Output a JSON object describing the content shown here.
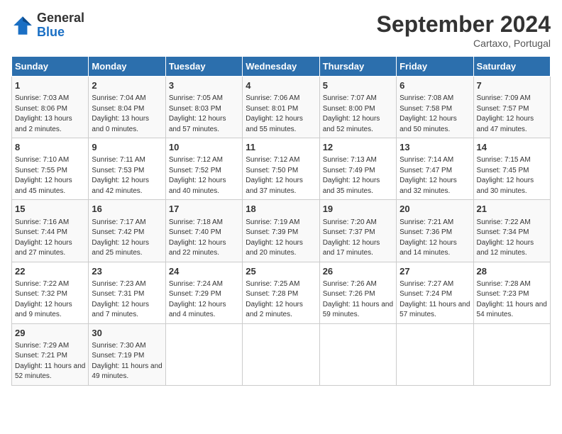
{
  "header": {
    "logo_general": "General",
    "logo_blue": "Blue",
    "month_title": "September 2024",
    "location": "Cartaxo, Portugal"
  },
  "days_of_week": [
    "Sunday",
    "Monday",
    "Tuesday",
    "Wednesday",
    "Thursday",
    "Friday",
    "Saturday"
  ],
  "weeks": [
    [
      {
        "day": "1",
        "sunrise": "Sunrise: 7:03 AM",
        "sunset": "Sunset: 8:06 PM",
        "daylight": "Daylight: 13 hours and 2 minutes."
      },
      {
        "day": "2",
        "sunrise": "Sunrise: 7:04 AM",
        "sunset": "Sunset: 8:04 PM",
        "daylight": "Daylight: 13 hours and 0 minutes."
      },
      {
        "day": "3",
        "sunrise": "Sunrise: 7:05 AM",
        "sunset": "Sunset: 8:03 PM",
        "daylight": "Daylight: 12 hours and 57 minutes."
      },
      {
        "day": "4",
        "sunrise": "Sunrise: 7:06 AM",
        "sunset": "Sunset: 8:01 PM",
        "daylight": "Daylight: 12 hours and 55 minutes."
      },
      {
        "day": "5",
        "sunrise": "Sunrise: 7:07 AM",
        "sunset": "Sunset: 8:00 PM",
        "daylight": "Daylight: 12 hours and 52 minutes."
      },
      {
        "day": "6",
        "sunrise": "Sunrise: 7:08 AM",
        "sunset": "Sunset: 7:58 PM",
        "daylight": "Daylight: 12 hours and 50 minutes."
      },
      {
        "day": "7",
        "sunrise": "Sunrise: 7:09 AM",
        "sunset": "Sunset: 7:57 PM",
        "daylight": "Daylight: 12 hours and 47 minutes."
      }
    ],
    [
      {
        "day": "8",
        "sunrise": "Sunrise: 7:10 AM",
        "sunset": "Sunset: 7:55 PM",
        "daylight": "Daylight: 12 hours and 45 minutes."
      },
      {
        "day": "9",
        "sunrise": "Sunrise: 7:11 AM",
        "sunset": "Sunset: 7:53 PM",
        "daylight": "Daylight: 12 hours and 42 minutes."
      },
      {
        "day": "10",
        "sunrise": "Sunrise: 7:12 AM",
        "sunset": "Sunset: 7:52 PM",
        "daylight": "Daylight: 12 hours and 40 minutes."
      },
      {
        "day": "11",
        "sunrise": "Sunrise: 7:12 AM",
        "sunset": "Sunset: 7:50 PM",
        "daylight": "Daylight: 12 hours and 37 minutes."
      },
      {
        "day": "12",
        "sunrise": "Sunrise: 7:13 AM",
        "sunset": "Sunset: 7:49 PM",
        "daylight": "Daylight: 12 hours and 35 minutes."
      },
      {
        "day": "13",
        "sunrise": "Sunrise: 7:14 AM",
        "sunset": "Sunset: 7:47 PM",
        "daylight": "Daylight: 12 hours and 32 minutes."
      },
      {
        "day": "14",
        "sunrise": "Sunrise: 7:15 AM",
        "sunset": "Sunset: 7:45 PM",
        "daylight": "Daylight: 12 hours and 30 minutes."
      }
    ],
    [
      {
        "day": "15",
        "sunrise": "Sunrise: 7:16 AM",
        "sunset": "Sunset: 7:44 PM",
        "daylight": "Daylight: 12 hours and 27 minutes."
      },
      {
        "day": "16",
        "sunrise": "Sunrise: 7:17 AM",
        "sunset": "Sunset: 7:42 PM",
        "daylight": "Daylight: 12 hours and 25 minutes."
      },
      {
        "day": "17",
        "sunrise": "Sunrise: 7:18 AM",
        "sunset": "Sunset: 7:40 PM",
        "daylight": "Daylight: 12 hours and 22 minutes."
      },
      {
        "day": "18",
        "sunrise": "Sunrise: 7:19 AM",
        "sunset": "Sunset: 7:39 PM",
        "daylight": "Daylight: 12 hours and 20 minutes."
      },
      {
        "day": "19",
        "sunrise": "Sunrise: 7:20 AM",
        "sunset": "Sunset: 7:37 PM",
        "daylight": "Daylight: 12 hours and 17 minutes."
      },
      {
        "day": "20",
        "sunrise": "Sunrise: 7:21 AM",
        "sunset": "Sunset: 7:36 PM",
        "daylight": "Daylight: 12 hours and 14 minutes."
      },
      {
        "day": "21",
        "sunrise": "Sunrise: 7:22 AM",
        "sunset": "Sunset: 7:34 PM",
        "daylight": "Daylight: 12 hours and 12 minutes."
      }
    ],
    [
      {
        "day": "22",
        "sunrise": "Sunrise: 7:22 AM",
        "sunset": "Sunset: 7:32 PM",
        "daylight": "Daylight: 12 hours and 9 minutes."
      },
      {
        "day": "23",
        "sunrise": "Sunrise: 7:23 AM",
        "sunset": "Sunset: 7:31 PM",
        "daylight": "Daylight: 12 hours and 7 minutes."
      },
      {
        "day": "24",
        "sunrise": "Sunrise: 7:24 AM",
        "sunset": "Sunset: 7:29 PM",
        "daylight": "Daylight: 12 hours and 4 minutes."
      },
      {
        "day": "25",
        "sunrise": "Sunrise: 7:25 AM",
        "sunset": "Sunset: 7:28 PM",
        "daylight": "Daylight: 12 hours and 2 minutes."
      },
      {
        "day": "26",
        "sunrise": "Sunrise: 7:26 AM",
        "sunset": "Sunset: 7:26 PM",
        "daylight": "Daylight: 11 hours and 59 minutes."
      },
      {
        "day": "27",
        "sunrise": "Sunrise: 7:27 AM",
        "sunset": "Sunset: 7:24 PM",
        "daylight": "Daylight: 11 hours and 57 minutes."
      },
      {
        "day": "28",
        "sunrise": "Sunrise: 7:28 AM",
        "sunset": "Sunset: 7:23 PM",
        "daylight": "Daylight: 11 hours and 54 minutes."
      }
    ],
    [
      {
        "day": "29",
        "sunrise": "Sunrise: 7:29 AM",
        "sunset": "Sunset: 7:21 PM",
        "daylight": "Daylight: 11 hours and 52 minutes."
      },
      {
        "day": "30",
        "sunrise": "Sunrise: 7:30 AM",
        "sunset": "Sunset: 7:19 PM",
        "daylight": "Daylight: 11 hours and 49 minutes."
      },
      null,
      null,
      null,
      null,
      null
    ]
  ]
}
